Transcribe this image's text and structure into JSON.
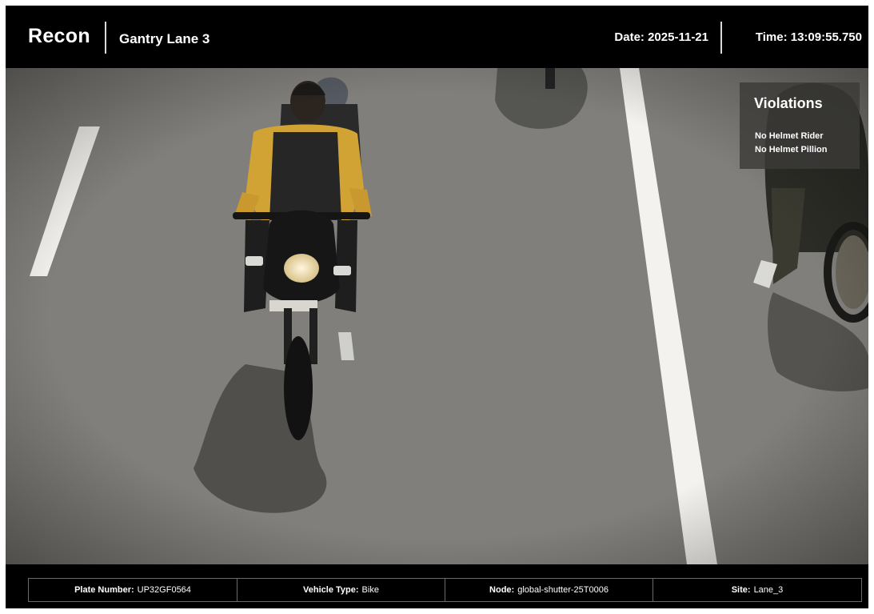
{
  "header": {
    "app_name": "Recon",
    "lane_name": "Gantry Lane 3",
    "date_label": "Date:",
    "date_value": "2025-11-21",
    "time_label": "Time:",
    "time_value": "13:09:55.750"
  },
  "violations": {
    "title": "Violations",
    "items": [
      "No Helmet Rider",
      "No Helmet Pillion"
    ]
  },
  "footer": {
    "fields": [
      {
        "label": "Plate Number:",
        "value": "UP32GF0564"
      },
      {
        "label": "Vehicle Type:",
        "value": "Bike"
      },
      {
        "label": "Node:",
        "value": "global-shutter-25T0006"
      },
      {
        "label": "Site:",
        "value": "Lane_3"
      }
    ]
  },
  "camera": {
    "scene": "road-camera-frame",
    "colors": {
      "road": "#807f7b",
      "lane_marking": "#f2f2f0",
      "rider_jacket": "#d1a234"
    }
  }
}
